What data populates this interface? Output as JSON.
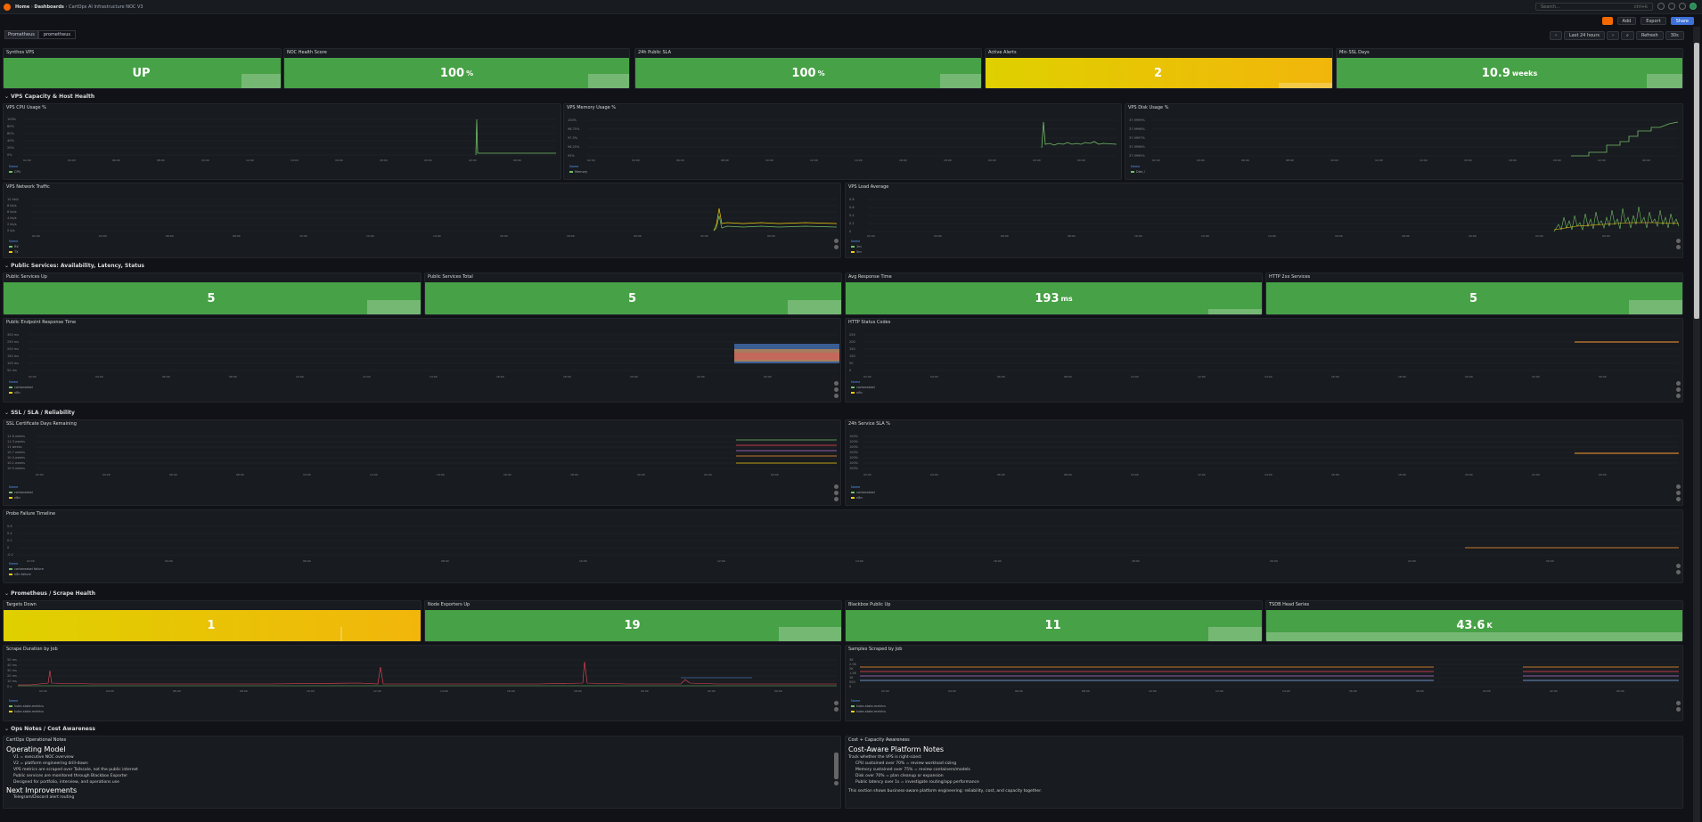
{
  "nav": {
    "home": "Home",
    "dashboards": "Dashboards",
    "current": "CartOps AI Infrastructure NOC V3",
    "search_placeholder": "Search...",
    "search_shortcut": "ctrl+k"
  },
  "toolbar": {
    "add": "Add",
    "export": "Export",
    "share": "Share",
    "time_range": "Last 24 hours",
    "refresh": "Refresh",
    "refresh_interval": "30s"
  },
  "variable": {
    "label": "Prometheus",
    "value": "prometheus"
  },
  "stats_top": [
    {
      "title": "Synthos VPS",
      "value": "UP",
      "unit": "",
      "color": "green"
    },
    {
      "title": "NOC Health Score",
      "value": "100",
      "unit": "%",
      "color": "green"
    },
    {
      "title": "24h Public SLA",
      "value": "100",
      "unit": "%",
      "color": "green"
    },
    {
      "title": "Active Alerts",
      "value": "2",
      "unit": "",
      "color": "yellow"
    },
    {
      "title": "Min SSL Days",
      "value": "10.9",
      "unit": "weeks",
      "color": "green"
    }
  ],
  "rows": {
    "vps": "VPS Capacity & Host Health",
    "public": "Public Services: Availability, Latency, Status",
    "ssl": "SSL / SLA / Reliability",
    "prom": "Prometheus / Scrape Health",
    "ops": "Ops Notes / Cost Awareness"
  },
  "vps_panels": {
    "cpu": {
      "title": "VPS CPU Usage %",
      "legend_header": "Name",
      "series": "CPU",
      "yticks": [
        "100%",
        "80%",
        "60%",
        "40%",
        "20%",
        "0%"
      ]
    },
    "memory": {
      "title": "VPS Memory Usage %",
      "legend_header": "Name",
      "series": "Memory",
      "yticks": [
        "100%",
        "98.75%",
        "97.5%",
        "96.25%",
        "95%"
      ]
    },
    "disk": {
      "title": "VPS Disk Usage %",
      "legend_header": "Name",
      "series": "Disk /",
      "yticks": [
        "37.9999%",
        "37.9998%",
        "37.9997%",
        "37.9996%",
        "37.9995%"
      ]
    },
    "network": {
      "title": "VPS Network Traffic",
      "legend_header": "Name",
      "series": [
        "RX",
        "TX"
      ],
      "yticks": [
        "10 kb/s",
        "8 kb/s",
        "6 kb/s",
        "4 kb/s",
        "2 kb/s",
        "0 b/s"
      ]
    },
    "load": {
      "title": "VPS Load Average",
      "legend_header": "Name",
      "series": [
        "1m",
        "5m"
      ],
      "yticks": [
        "0.8",
        "0.6",
        "0.4",
        "0.2",
        "0"
      ]
    }
  },
  "xticks_short": [
    "02:00",
    "04:00",
    "06:00",
    "08:00",
    "10:00",
    "12:00",
    "14:00",
    "16:00",
    "18:00",
    "20:00",
    "22:00",
    "00:00"
  ],
  "stats_public": [
    {
      "title": "Public Services Up",
      "value": "5",
      "unit": ""
    },
    {
      "title": "Public Services Total",
      "value": "5",
      "unit": ""
    },
    {
      "title": "Avg Response Time",
      "value": "193",
      "unit": "ms"
    },
    {
      "title": "HTTP 2xx Services",
      "value": "5",
      "unit": ""
    }
  ],
  "public_panels": {
    "response": {
      "title": "Public Endpoint Response Time",
      "legend_header": "Name",
      "series": [
        "cartoneatwi",
        "n8n"
      ],
      "yticks": [
        "300 ms",
        "250 ms",
        "200 ms",
        "150 ms",
        "100 ms",
        "50 ms"
      ]
    },
    "http": {
      "title": "HTTP Status Codes",
      "legend_header": "Name",
      "series": [
        "cartoneatwi",
        "n8n"
      ],
      "yticks": [
        "250",
        "200",
        "150",
        "100",
        "50",
        "0"
      ]
    }
  },
  "ssl_panels": {
    "cert": {
      "title": "SSL Certificate Days Remaining",
      "legend_header": "Name",
      "series": [
        "cartoneatwi",
        "n8n"
      ],
      "yticks": [
        "11.6 weeks",
        "11.3 weeks",
        "11 weeks",
        "10.7 weeks",
        "10.4 weeks",
        "10.1 weeks",
        "10.9 weeks"
      ]
    },
    "sla": {
      "title": "24h Service SLA %",
      "legend_header": "Name",
      "series": [
        "cartoneatwi",
        "n8n"
      ],
      "yticks": [
        "100%",
        "100%",
        "100%",
        "100%",
        "100%",
        "100%",
        "100%"
      ]
    },
    "probe": {
      "title": "Probe Failure Timeline",
      "legend_header": "Name",
      "series": [
        "cartoneatwi failure",
        "n8n failure"
      ],
      "yticks": [
        "0.6",
        "0.4",
        "0.2",
        "0",
        "-0.2"
      ]
    }
  },
  "stats_prom": [
    {
      "title": "Targets Down",
      "value": "1",
      "unit": "",
      "color": "yellow"
    },
    {
      "title": "Node Exporters Up",
      "value": "19",
      "unit": "",
      "color": "green"
    },
    {
      "title": "Blackbox Public Up",
      "value": "11",
      "unit": "",
      "color": "green"
    },
    {
      "title": "TSDB Head Series",
      "value": "43.6",
      "unit": "K",
      "color": "green"
    }
  ],
  "prom_panels": {
    "scrape": {
      "title": "Scrape Duration by Job",
      "legend_header": "Name",
      "series": [
        "kube-state-metrics",
        "kube-state-metrics"
      ],
      "yticks": [
        "50 ms",
        "40 ms",
        "30 ms",
        "20 ms",
        "10 ms",
        "0 s"
      ]
    },
    "samples": {
      "title": "Samples Scraped by Job",
      "legend_header": "Name",
      "series": [
        "kube-state-metrics",
        "kube-state-metrics"
      ],
      "yticks": [
        "3K",
        "2.5K",
        "2K",
        "1.5K",
        "1K",
        "500",
        "0"
      ]
    }
  },
  "ops_left": {
    "title": "CartOps Operational Notes",
    "heading": "Operating Model",
    "items": [
      "V1 = executive NOC overview",
      "V2 = platform engineering drill-down",
      "VPS metrics are scraped over Tailscale, not the public internet",
      "Public services are monitored through Blackbox Exporter",
      "Designed for portfolio, interview, and operations use"
    ],
    "heading2": "Next Improvements",
    "more": "Telegram/Discord alert routing"
  },
  "ops_right": {
    "title": "Cost + Capacity Awareness",
    "heading": "Cost-Aware Platform Notes",
    "intro": "Track whether the VPS is right-sized:",
    "items": [
      "CPU sustained over 70% = review workload sizing",
      "Memory sustained over 75% = review containers/models",
      "Disk over 70% = plan cleanup or expansion",
      "Public latency over 1s = investigate routing/app performance"
    ],
    "footer": "This section shows business-aware platform engineering: reliability, cost, and capacity together."
  }
}
